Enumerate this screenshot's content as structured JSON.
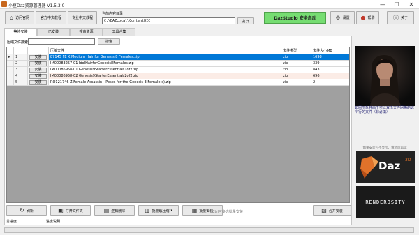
{
  "window": {
    "title": "小豆Daz资源管理器 V1.5.3.0",
    "minimize": "—",
    "maximize": "☐",
    "close": "✕"
  },
  "toolbar": {
    "visit_site": "访问官网",
    "official_tutorial": "官方中文教程",
    "pro_tutorial": "专业中文教程",
    "dir_label": "当前内容目录",
    "dir_value": "C:\\DAZLocal\\ContentDIC",
    "open_label": "打开",
    "daz_start": "DazStudio 安全启动",
    "settings": "设置",
    "help": "帮助",
    "about": "关于"
  },
  "tabs": [
    "等待安装",
    "已安装",
    "搜索资源",
    "工具合集"
  ],
  "search": {
    "label": "压缩文件搜索",
    "button": "搜索"
  },
  "table": {
    "columns": [
      "压缩文件",
      "文件类型",
      "文件大小MB"
    ],
    "install_label": "安装",
    "rows": [
      {
        "marker": "▸",
        "num": "1",
        "name": "87145 FE K Medium Hair for Genesis 8 Females.zip",
        "type": "zip",
        "size": "1698",
        "state": "selected"
      },
      {
        "marker": "",
        "num": "2",
        "name": "IM00083257-01 IdolHairforGenesis8Females.zip",
        "type": "zip",
        "size": "339",
        "state": "normal"
      },
      {
        "marker": "",
        "num": "3",
        "name": "IM00086958-01 Genesis9StarterEssentials1of2.zip",
        "type": "zip",
        "size": "843",
        "state": "normal"
      },
      {
        "marker": "",
        "num": "4",
        "name": "IM00086958-02 Genesis9StarterEssentials2of2.zip",
        "type": "zip",
        "size": "696",
        "state": "pink"
      },
      {
        "marker": "",
        "num": "5",
        "name": "RO121746 Z Female Assassin - Poses for the Genesis 3 Female(s).zip",
        "type": "zip",
        "size": "2",
        "state": "normal"
      }
    ]
  },
  "sidebar": {
    "ad_text": "如图形象并由于可以双击文件网格的这个行的文件（非必填）",
    "ad_note": "如果安装包不显示，请稍后再试",
    "logo_daz": "Daz",
    "logo_daz_sup": "3D",
    "logo_render": "RENDEROSITY"
  },
  "bottom_toolbar": {
    "refresh": "刷新",
    "open_folder": "打开文件夹",
    "logic_delete": "逻辑删除",
    "batch_decompress": "批量解压缩",
    "batch_install": "批量安装",
    "hint": "Ctrl可多选批量安装",
    "merge_install": "合并安装"
  },
  "status": {
    "total_progress": "总进度",
    "progress_desc": "进度说明"
  },
  "colors": {
    "selection": "#0078d7",
    "daz_button": "#76dd72"
  }
}
